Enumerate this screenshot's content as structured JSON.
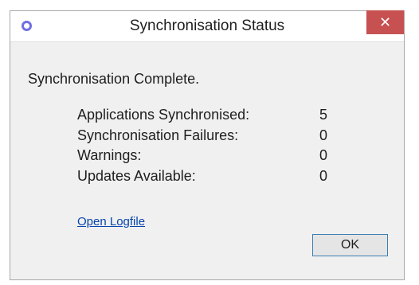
{
  "window": {
    "title": "Synchronisation Status",
    "close_label": "✕",
    "app_icon": "ring-icon",
    "accent_color": "#6f6fe3",
    "close_color": "#c75050"
  },
  "main": {
    "status_heading": "Synchronisation Complete.",
    "stats": [
      {
        "label": "Applications Synchronised:",
        "value": "5"
      },
      {
        "label": "Synchronisation Failures:",
        "value": "0"
      },
      {
        "label": "Warnings:",
        "value": "0"
      },
      {
        "label": "Updates Available:",
        "value": "0"
      }
    ],
    "logfile_link": "Open Logfile"
  },
  "footer": {
    "ok_label": "OK"
  }
}
